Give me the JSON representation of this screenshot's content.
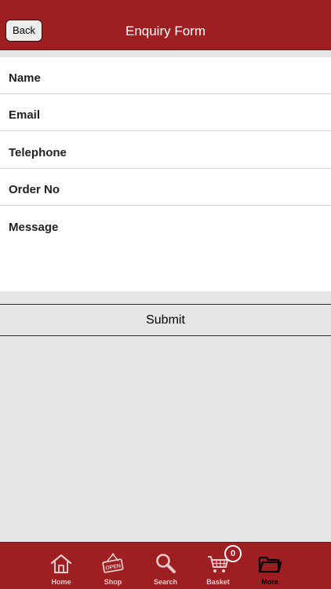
{
  "header": {
    "back_label": "Back",
    "title": "Enquiry Form"
  },
  "form": {
    "fields": [
      {
        "label": "Name"
      },
      {
        "label": "Email"
      },
      {
        "label": "Telephone"
      },
      {
        "label": "Order No"
      },
      {
        "label": "Message"
      }
    ],
    "submit_label": "Submit"
  },
  "tabbar": {
    "tabs": [
      {
        "label": "Home",
        "icon": "home-icon"
      },
      {
        "label": "Shop",
        "icon": "open-sign-icon"
      },
      {
        "label": "Search",
        "icon": "search-icon"
      },
      {
        "label": "Basket",
        "icon": "basket-icon",
        "badge": "0"
      },
      {
        "label": "More",
        "icon": "folder-icon",
        "active": true
      }
    ]
  },
  "colors": {
    "brand": "#9d1f21",
    "background": "#e6e6e6",
    "tab_label": "#e9c8c8"
  }
}
